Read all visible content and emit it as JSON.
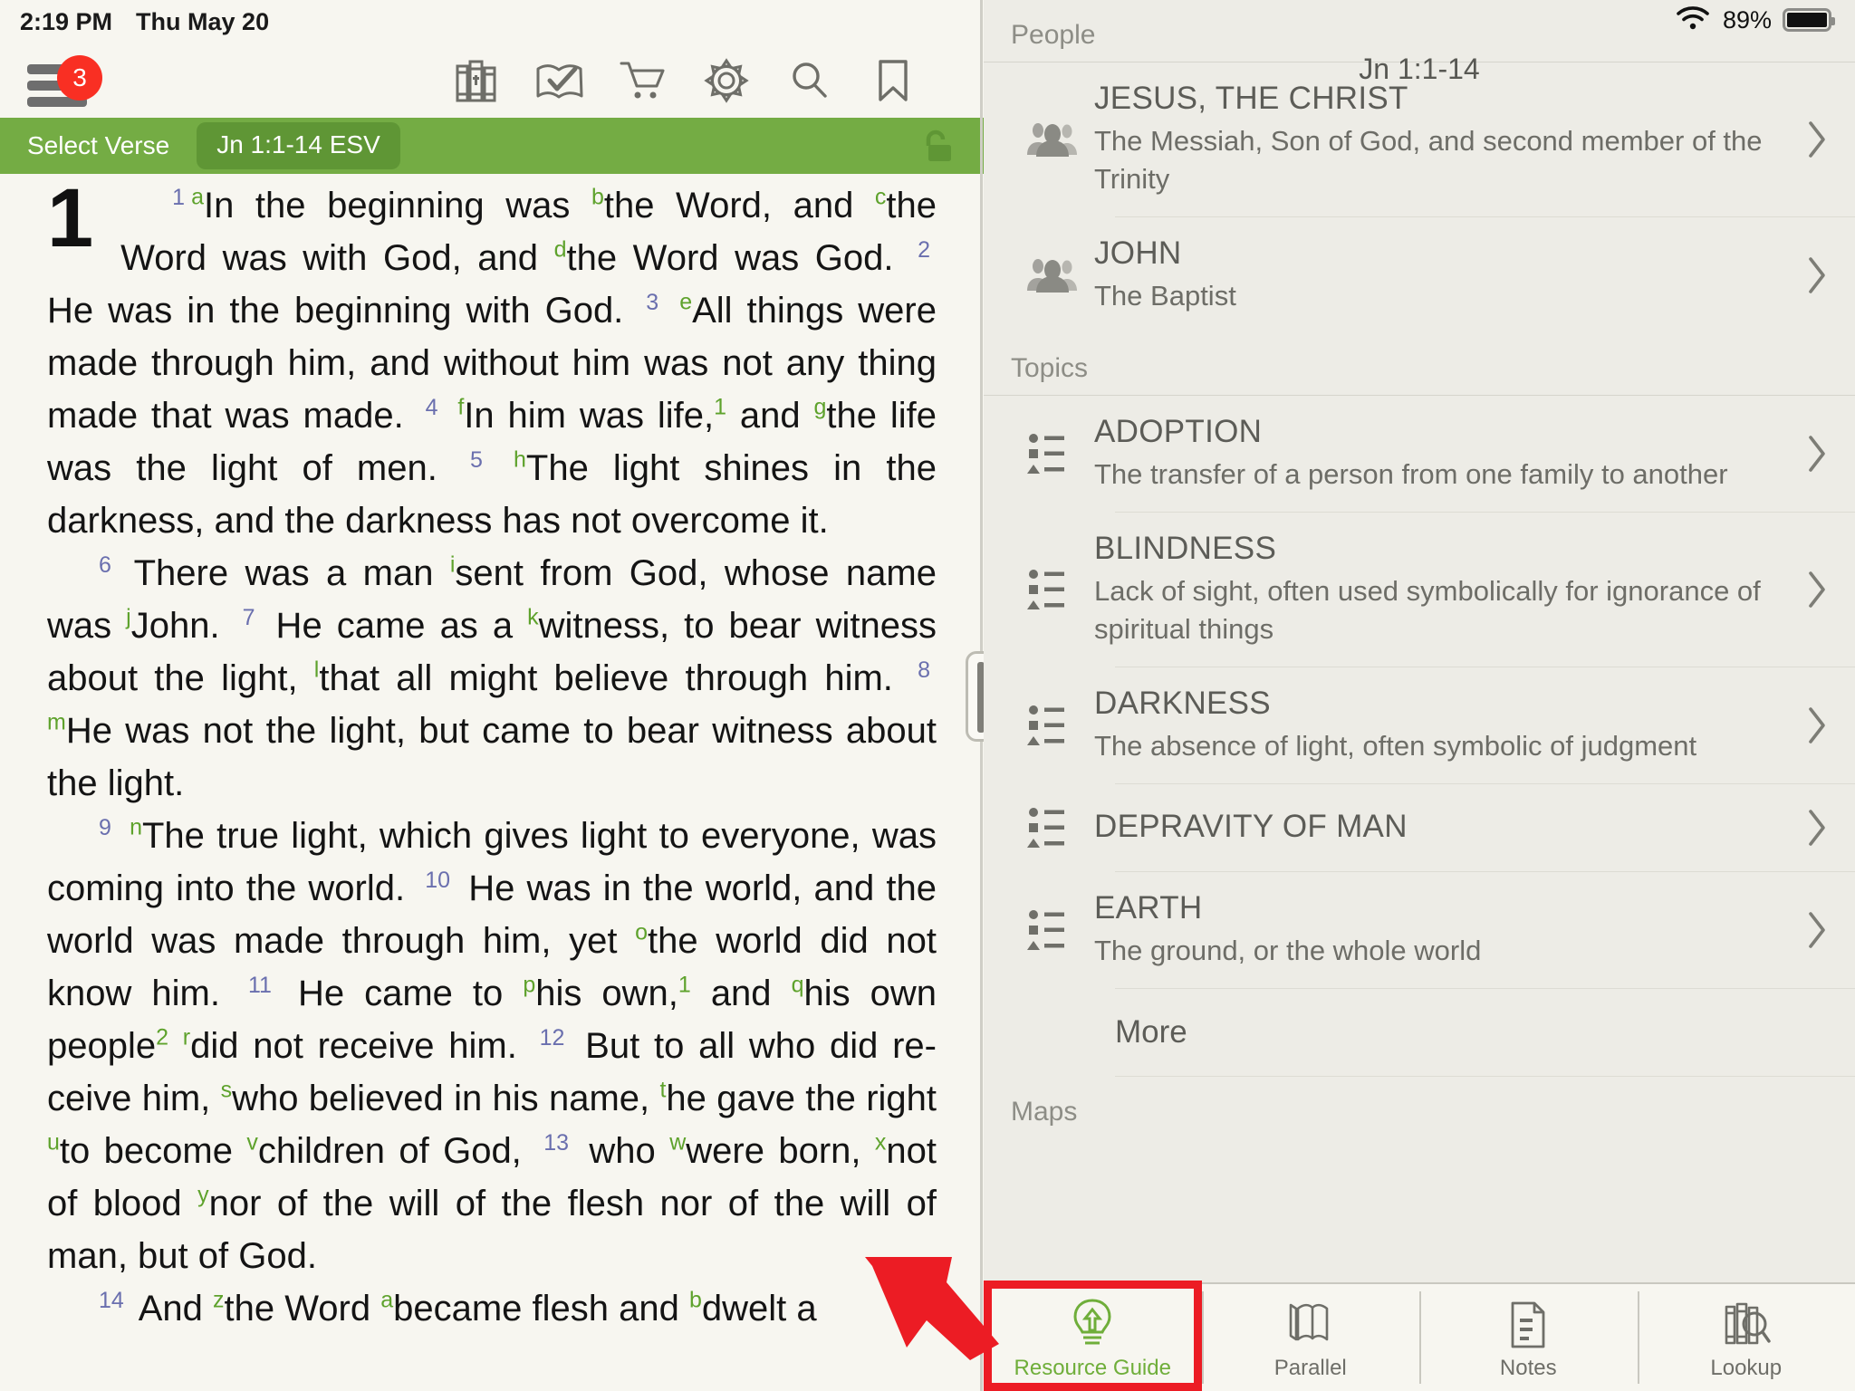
{
  "status_bar": {
    "time": "2:19 PM",
    "date": "Thu May 20",
    "wifi_icon": "wifi-icon",
    "battery_percent": "89%",
    "battery_icon": "battery-icon"
  },
  "toolbar": {
    "menu_icon": "hamburger-menu-icon",
    "menu_badge": "3",
    "items": [
      {
        "name": "library-icon",
        "label": "Library"
      },
      {
        "name": "reading-plan-icon",
        "label": "Reading Plan"
      },
      {
        "name": "store-cart-icon",
        "label": "Store"
      },
      {
        "name": "settings-gear-icon",
        "label": "Settings"
      },
      {
        "name": "search-icon",
        "label": "Search"
      },
      {
        "name": "bookmark-icon",
        "label": "Bookmarks"
      }
    ]
  },
  "verse_bar": {
    "label": "Select Verse",
    "reference_chip": "Jn 1:1-14 ESV",
    "lock_icon": "unlocked-padlock-icon"
  },
  "bible": {
    "chapter_number": "1",
    "translation": "ESV",
    "book_reference": "Jn 1:1-14",
    "verses": [
      {
        "number": "1",
        "text_segments": [
          {
            "xref": "a",
            "text": "In the beginning was "
          },
          {
            "xref": "b",
            "text": "the Word, and "
          },
          {
            "xref": "c",
            "text": "the Word was with God, and "
          },
          {
            "xref": "d",
            "text": "the Word was God."
          }
        ]
      },
      {
        "number": "2",
        "text_segments": [
          {
            "xref": "",
            "text": "He was in the beginning with God."
          }
        ]
      },
      {
        "number": "3",
        "text_segments": [
          {
            "xref": "e",
            "text": "All things were made through him, and without him was not any thing made that was made."
          }
        ]
      },
      {
        "number": "4",
        "text_segments": [
          {
            "xref": "f",
            "text": "In him was life,"
          },
          {
            "footnote": "1",
            "text": " and "
          },
          {
            "xref": "g",
            "text": "the life was the light of men."
          }
        ]
      },
      {
        "number": "5",
        "text_segments": [
          {
            "xref": "h",
            "text": "The light shines in the darkness, and the darkness has not overcome it."
          }
        ]
      },
      {
        "number": "6",
        "text_segments": [
          {
            "xref": "",
            "text": "There was a man "
          },
          {
            "xref": "i",
            "text": "sent from God, whose name was "
          },
          {
            "xref": "j",
            "text": "John."
          }
        ]
      },
      {
        "number": "7",
        "text_segments": [
          {
            "xref": "",
            "text": "He came as a "
          },
          {
            "xref": "k",
            "text": "witness, to bear witness about the light, "
          },
          {
            "xref": "l",
            "text": "that all might believe through him."
          }
        ]
      },
      {
        "number": "8",
        "text_segments": [
          {
            "xref": "m",
            "text": "He was not the light, but came to bear witness about the light."
          }
        ]
      },
      {
        "number": "9",
        "text_segments": [
          {
            "xref": "n",
            "text": "The true light, which gives light to everyone, was coming into the world."
          }
        ]
      },
      {
        "number": "10",
        "text_segments": [
          {
            "xref": "",
            "text": "He was in the world, and the world was made through him, yet "
          },
          {
            "xref": "o",
            "text": "the world did not know him."
          }
        ]
      },
      {
        "number": "11",
        "text_segments": [
          {
            "xref": "",
            "text": "He came to "
          },
          {
            "xref": "p",
            "text": "his own,"
          },
          {
            "footnote": "1",
            "text": " and "
          },
          {
            "xref": "q",
            "text": "his own people"
          },
          {
            "footnote": "2",
            "text": " "
          },
          {
            "xref": "r",
            "text": "did not receive him."
          }
        ]
      },
      {
        "number": "12",
        "text_segments": [
          {
            "xref": "",
            "text": "But to all who did receive him, "
          },
          {
            "xref": "s",
            "text": "who believed in his name, "
          },
          {
            "xref": "t",
            "text": "he gave the right "
          },
          {
            "xref": "u",
            "text": "to become "
          },
          {
            "xref": "v",
            "text": "children of God,"
          }
        ]
      },
      {
        "number": "13",
        "text_segments": [
          {
            "xref": "",
            "text": "who "
          },
          {
            "xref": "w",
            "text": "were born, "
          },
          {
            "xref": "x",
            "text": "not of blood "
          },
          {
            "xref": "y",
            "text": "nor of the will of the flesh nor of the will of man, but of God."
          }
        ]
      },
      {
        "number": "14",
        "text_segments": [
          {
            "xref": "",
            "text": "And "
          },
          {
            "xref": "z",
            "text": "the Word "
          },
          {
            "xref": "a",
            "text": "became flesh and "
          },
          {
            "xref": "b",
            "text": "dwelt a"
          }
        ]
      }
    ],
    "rendered_lines": [
      "1 aIn the beginning was bthe Word, and cthe Word was with God, and dthe Word was God.",
      "2 He was in the beginning with God.",
      "3 eAll things were made through him, and without him was not any thing made that was made.",
      "4 fIn him was life,1 and gthe life was the light of men.",
      "5 hThe light shines in the darkness, and the darkness has not overcome it.",
      "6 There was a man isent from God, whose name was jJohn.",
      "7 He came as a kwitness, to bear witness about the light, lthat all might believe through him.",
      "8 mHe was not the light, but came to bear witness about the light.",
      "9 nThe true light, which gives light to everyone, was coming into the world.",
      "10 He was in the world, and the world was made through him, yet othe world did not know him.",
      "11 He came to phis own,1 and qhis own people2 rdid not receive him.",
      "12 But to all who did receive him, swho believed in his name, the gave the right uto become vchildren of God,",
      "13 who wwere born, xnot of blood ynor of the will of the flesh nor of the will of man, but of God.",
      "14 And zthe Word abecame flesh and bdwelt a"
    ]
  },
  "resource_panel": {
    "title": "Jn 1:1-14",
    "sections": [
      {
        "heading": "People",
        "icon": "people-group-icon",
        "items": [
          {
            "title": "JESUS, THE CHRIST",
            "subtitle": "The Messiah, Son of God, and second member of the Trinity"
          },
          {
            "title": "JOHN",
            "subtitle": "The Baptist"
          }
        ]
      },
      {
        "heading": "Topics",
        "icon": "topic-list-icon",
        "items": [
          {
            "title": "ADOPTION",
            "subtitle": "The transfer of a person from one family to another"
          },
          {
            "title": "BLINDNESS",
            "subtitle": "Lack of sight, often used symbolically for ignorance of spiritual things"
          },
          {
            "title": "DARKNESS",
            "subtitle": "The absence of light, often symbolic of judgment"
          },
          {
            "title": "DEPRAVITY OF MAN",
            "subtitle": ""
          },
          {
            "title": "EARTH",
            "subtitle": "The ground, or the whole world"
          }
        ],
        "more_label": "More"
      },
      {
        "heading": "Maps",
        "icon": "",
        "items": []
      }
    ],
    "chevron_icon": "chevron-right-icon"
  },
  "tab_bar": {
    "tabs": [
      {
        "label": "Resource Guide",
        "icon": "lightbulb-arrow-icon",
        "active": true
      },
      {
        "label": "Parallel",
        "icon": "parallel-books-icon",
        "active": false
      },
      {
        "label": "Notes",
        "icon": "note-document-icon",
        "active": false
      },
      {
        "label": "Lookup",
        "icon": "book-magnifier-icon",
        "active": false
      }
    ],
    "highlight_color": "#ec1c24",
    "active_color": "#6fae3a"
  },
  "annotation": {
    "arrow_icon": "red-pointer-arrow",
    "arrow_color": "#ec1c24"
  },
  "colors": {
    "accent_green": "#74ac44",
    "chip_green": "#5f9635",
    "badge_red": "#f92f23",
    "left_bg": "#f7f6f0",
    "right_bg": "#edece6",
    "verse_number": "#6a6fae",
    "cross_ref": "#5ea22c"
  }
}
